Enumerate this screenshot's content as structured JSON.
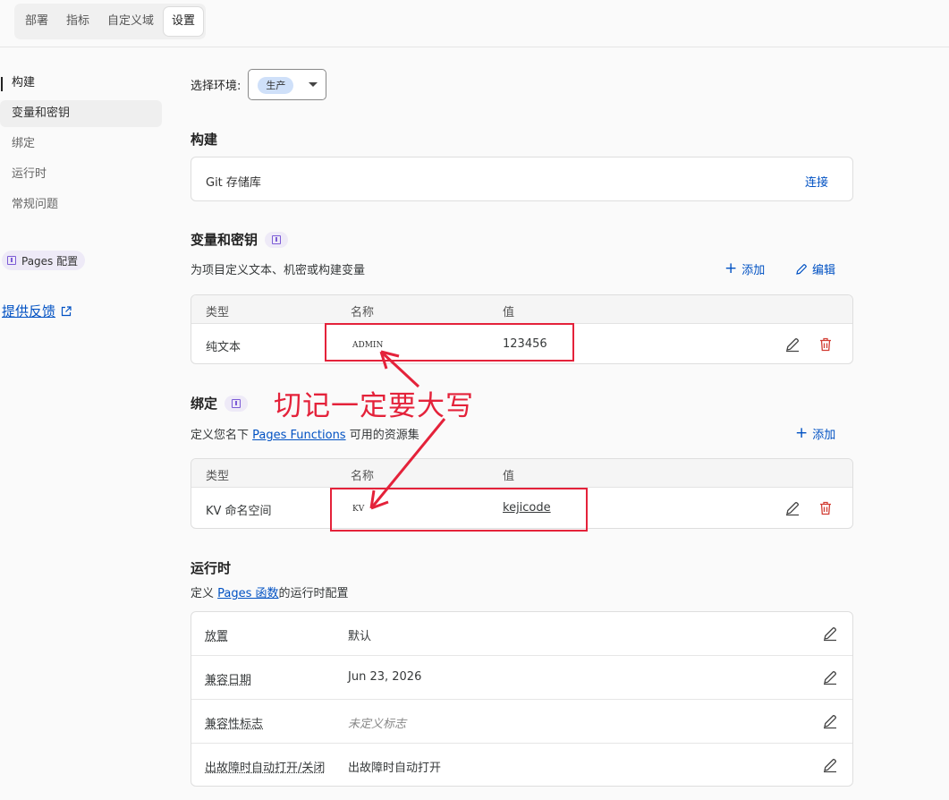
{
  "tabs": [
    {
      "label": "部署"
    },
    {
      "label": "指标"
    },
    {
      "label": "自定义域"
    },
    {
      "label": "设置"
    }
  ],
  "sidebar": {
    "items": [
      {
        "label": "构建"
      },
      {
        "label": "变量和密钥"
      },
      {
        "label": "绑定"
      },
      {
        "label": "运行时"
      },
      {
        "label": "常规问题"
      }
    ],
    "pages_config": "Pages 配置",
    "feedback": "提供反馈"
  },
  "environment": {
    "label": "选择环境:",
    "value": "生产"
  },
  "build": {
    "title": "构建",
    "git_label": "Git 存储库",
    "connect_label": "连接"
  },
  "variables": {
    "title": "变量和密钥",
    "subtitle": "为项目定义文本、机密或构建变量",
    "add_label": "添加",
    "edit_label": "编辑",
    "headers": [
      "类型",
      "名称",
      "值"
    ],
    "rows": [
      {
        "type": "纯文本",
        "name": "ADMIN",
        "value": "123456"
      }
    ]
  },
  "bindings": {
    "title": "绑定",
    "subtitle_prefix": "定义您名下 ",
    "subtitle_link": "Pages Functions",
    "subtitle_suffix": " 可用的资源集",
    "add_label": "添加",
    "headers": [
      "类型",
      "名称",
      "值"
    ],
    "rows": [
      {
        "type": "KV 命名空间",
        "name": "KV",
        "value": "kejicode"
      }
    ]
  },
  "runtime": {
    "title": "运行时",
    "subtitle_prefix": "定义 ",
    "subtitle_link": "Pages 函数",
    "subtitle_suffix": "的运行时配置",
    "rows": [
      {
        "key": "放置",
        "value": "默认"
      },
      {
        "key": "兼容日期",
        "value": "Jun 23, 2026"
      },
      {
        "key": "兼容性标志",
        "value": "未定义标志"
      },
      {
        "key": "出故障时自动打开/关闭",
        "value": "出故障时自动打开"
      }
    ]
  },
  "annotation": {
    "text": "切记一定要大写"
  },
  "colors": {
    "accent": "#0051c3",
    "danger": "#d23d33",
    "annotation": "#e4223a",
    "badge": "#eeeaf7"
  }
}
